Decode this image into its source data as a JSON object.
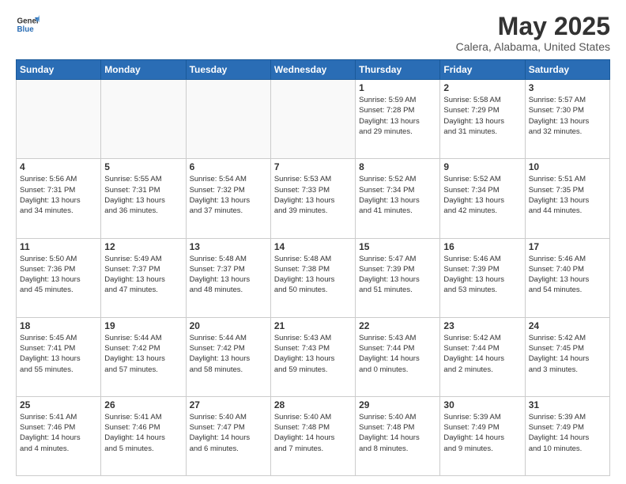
{
  "logo": {
    "line1": "General",
    "line2": "Blue"
  },
  "title": "May 2025",
  "subtitle": "Calera, Alabama, United States",
  "weekdays": [
    "Sunday",
    "Monday",
    "Tuesday",
    "Wednesday",
    "Thursday",
    "Friday",
    "Saturday"
  ],
  "weeks": [
    [
      {
        "day": "",
        "info": ""
      },
      {
        "day": "",
        "info": ""
      },
      {
        "day": "",
        "info": ""
      },
      {
        "day": "",
        "info": ""
      },
      {
        "day": "1",
        "info": "Sunrise: 5:59 AM\nSunset: 7:28 PM\nDaylight: 13 hours\nand 29 minutes."
      },
      {
        "day": "2",
        "info": "Sunrise: 5:58 AM\nSunset: 7:29 PM\nDaylight: 13 hours\nand 31 minutes."
      },
      {
        "day": "3",
        "info": "Sunrise: 5:57 AM\nSunset: 7:30 PM\nDaylight: 13 hours\nand 32 minutes."
      }
    ],
    [
      {
        "day": "4",
        "info": "Sunrise: 5:56 AM\nSunset: 7:31 PM\nDaylight: 13 hours\nand 34 minutes."
      },
      {
        "day": "5",
        "info": "Sunrise: 5:55 AM\nSunset: 7:31 PM\nDaylight: 13 hours\nand 36 minutes."
      },
      {
        "day": "6",
        "info": "Sunrise: 5:54 AM\nSunset: 7:32 PM\nDaylight: 13 hours\nand 37 minutes."
      },
      {
        "day": "7",
        "info": "Sunrise: 5:53 AM\nSunset: 7:33 PM\nDaylight: 13 hours\nand 39 minutes."
      },
      {
        "day": "8",
        "info": "Sunrise: 5:52 AM\nSunset: 7:34 PM\nDaylight: 13 hours\nand 41 minutes."
      },
      {
        "day": "9",
        "info": "Sunrise: 5:52 AM\nSunset: 7:34 PM\nDaylight: 13 hours\nand 42 minutes."
      },
      {
        "day": "10",
        "info": "Sunrise: 5:51 AM\nSunset: 7:35 PM\nDaylight: 13 hours\nand 44 minutes."
      }
    ],
    [
      {
        "day": "11",
        "info": "Sunrise: 5:50 AM\nSunset: 7:36 PM\nDaylight: 13 hours\nand 45 minutes."
      },
      {
        "day": "12",
        "info": "Sunrise: 5:49 AM\nSunset: 7:37 PM\nDaylight: 13 hours\nand 47 minutes."
      },
      {
        "day": "13",
        "info": "Sunrise: 5:48 AM\nSunset: 7:37 PM\nDaylight: 13 hours\nand 48 minutes."
      },
      {
        "day": "14",
        "info": "Sunrise: 5:48 AM\nSunset: 7:38 PM\nDaylight: 13 hours\nand 50 minutes."
      },
      {
        "day": "15",
        "info": "Sunrise: 5:47 AM\nSunset: 7:39 PM\nDaylight: 13 hours\nand 51 minutes."
      },
      {
        "day": "16",
        "info": "Sunrise: 5:46 AM\nSunset: 7:39 PM\nDaylight: 13 hours\nand 53 minutes."
      },
      {
        "day": "17",
        "info": "Sunrise: 5:46 AM\nSunset: 7:40 PM\nDaylight: 13 hours\nand 54 minutes."
      }
    ],
    [
      {
        "day": "18",
        "info": "Sunrise: 5:45 AM\nSunset: 7:41 PM\nDaylight: 13 hours\nand 55 minutes."
      },
      {
        "day": "19",
        "info": "Sunrise: 5:44 AM\nSunset: 7:42 PM\nDaylight: 13 hours\nand 57 minutes."
      },
      {
        "day": "20",
        "info": "Sunrise: 5:44 AM\nSunset: 7:42 PM\nDaylight: 13 hours\nand 58 minutes."
      },
      {
        "day": "21",
        "info": "Sunrise: 5:43 AM\nSunset: 7:43 PM\nDaylight: 13 hours\nand 59 minutes."
      },
      {
        "day": "22",
        "info": "Sunrise: 5:43 AM\nSunset: 7:44 PM\nDaylight: 14 hours\nand 0 minutes."
      },
      {
        "day": "23",
        "info": "Sunrise: 5:42 AM\nSunset: 7:44 PM\nDaylight: 14 hours\nand 2 minutes."
      },
      {
        "day": "24",
        "info": "Sunrise: 5:42 AM\nSunset: 7:45 PM\nDaylight: 14 hours\nand 3 minutes."
      }
    ],
    [
      {
        "day": "25",
        "info": "Sunrise: 5:41 AM\nSunset: 7:46 PM\nDaylight: 14 hours\nand 4 minutes."
      },
      {
        "day": "26",
        "info": "Sunrise: 5:41 AM\nSunset: 7:46 PM\nDaylight: 14 hours\nand 5 minutes."
      },
      {
        "day": "27",
        "info": "Sunrise: 5:40 AM\nSunset: 7:47 PM\nDaylight: 14 hours\nand 6 minutes."
      },
      {
        "day": "28",
        "info": "Sunrise: 5:40 AM\nSunset: 7:48 PM\nDaylight: 14 hours\nand 7 minutes."
      },
      {
        "day": "29",
        "info": "Sunrise: 5:40 AM\nSunset: 7:48 PM\nDaylight: 14 hours\nand 8 minutes."
      },
      {
        "day": "30",
        "info": "Sunrise: 5:39 AM\nSunset: 7:49 PM\nDaylight: 14 hours\nand 9 minutes."
      },
      {
        "day": "31",
        "info": "Sunrise: 5:39 AM\nSunset: 7:49 PM\nDaylight: 14 hours\nand 10 minutes."
      }
    ]
  ]
}
